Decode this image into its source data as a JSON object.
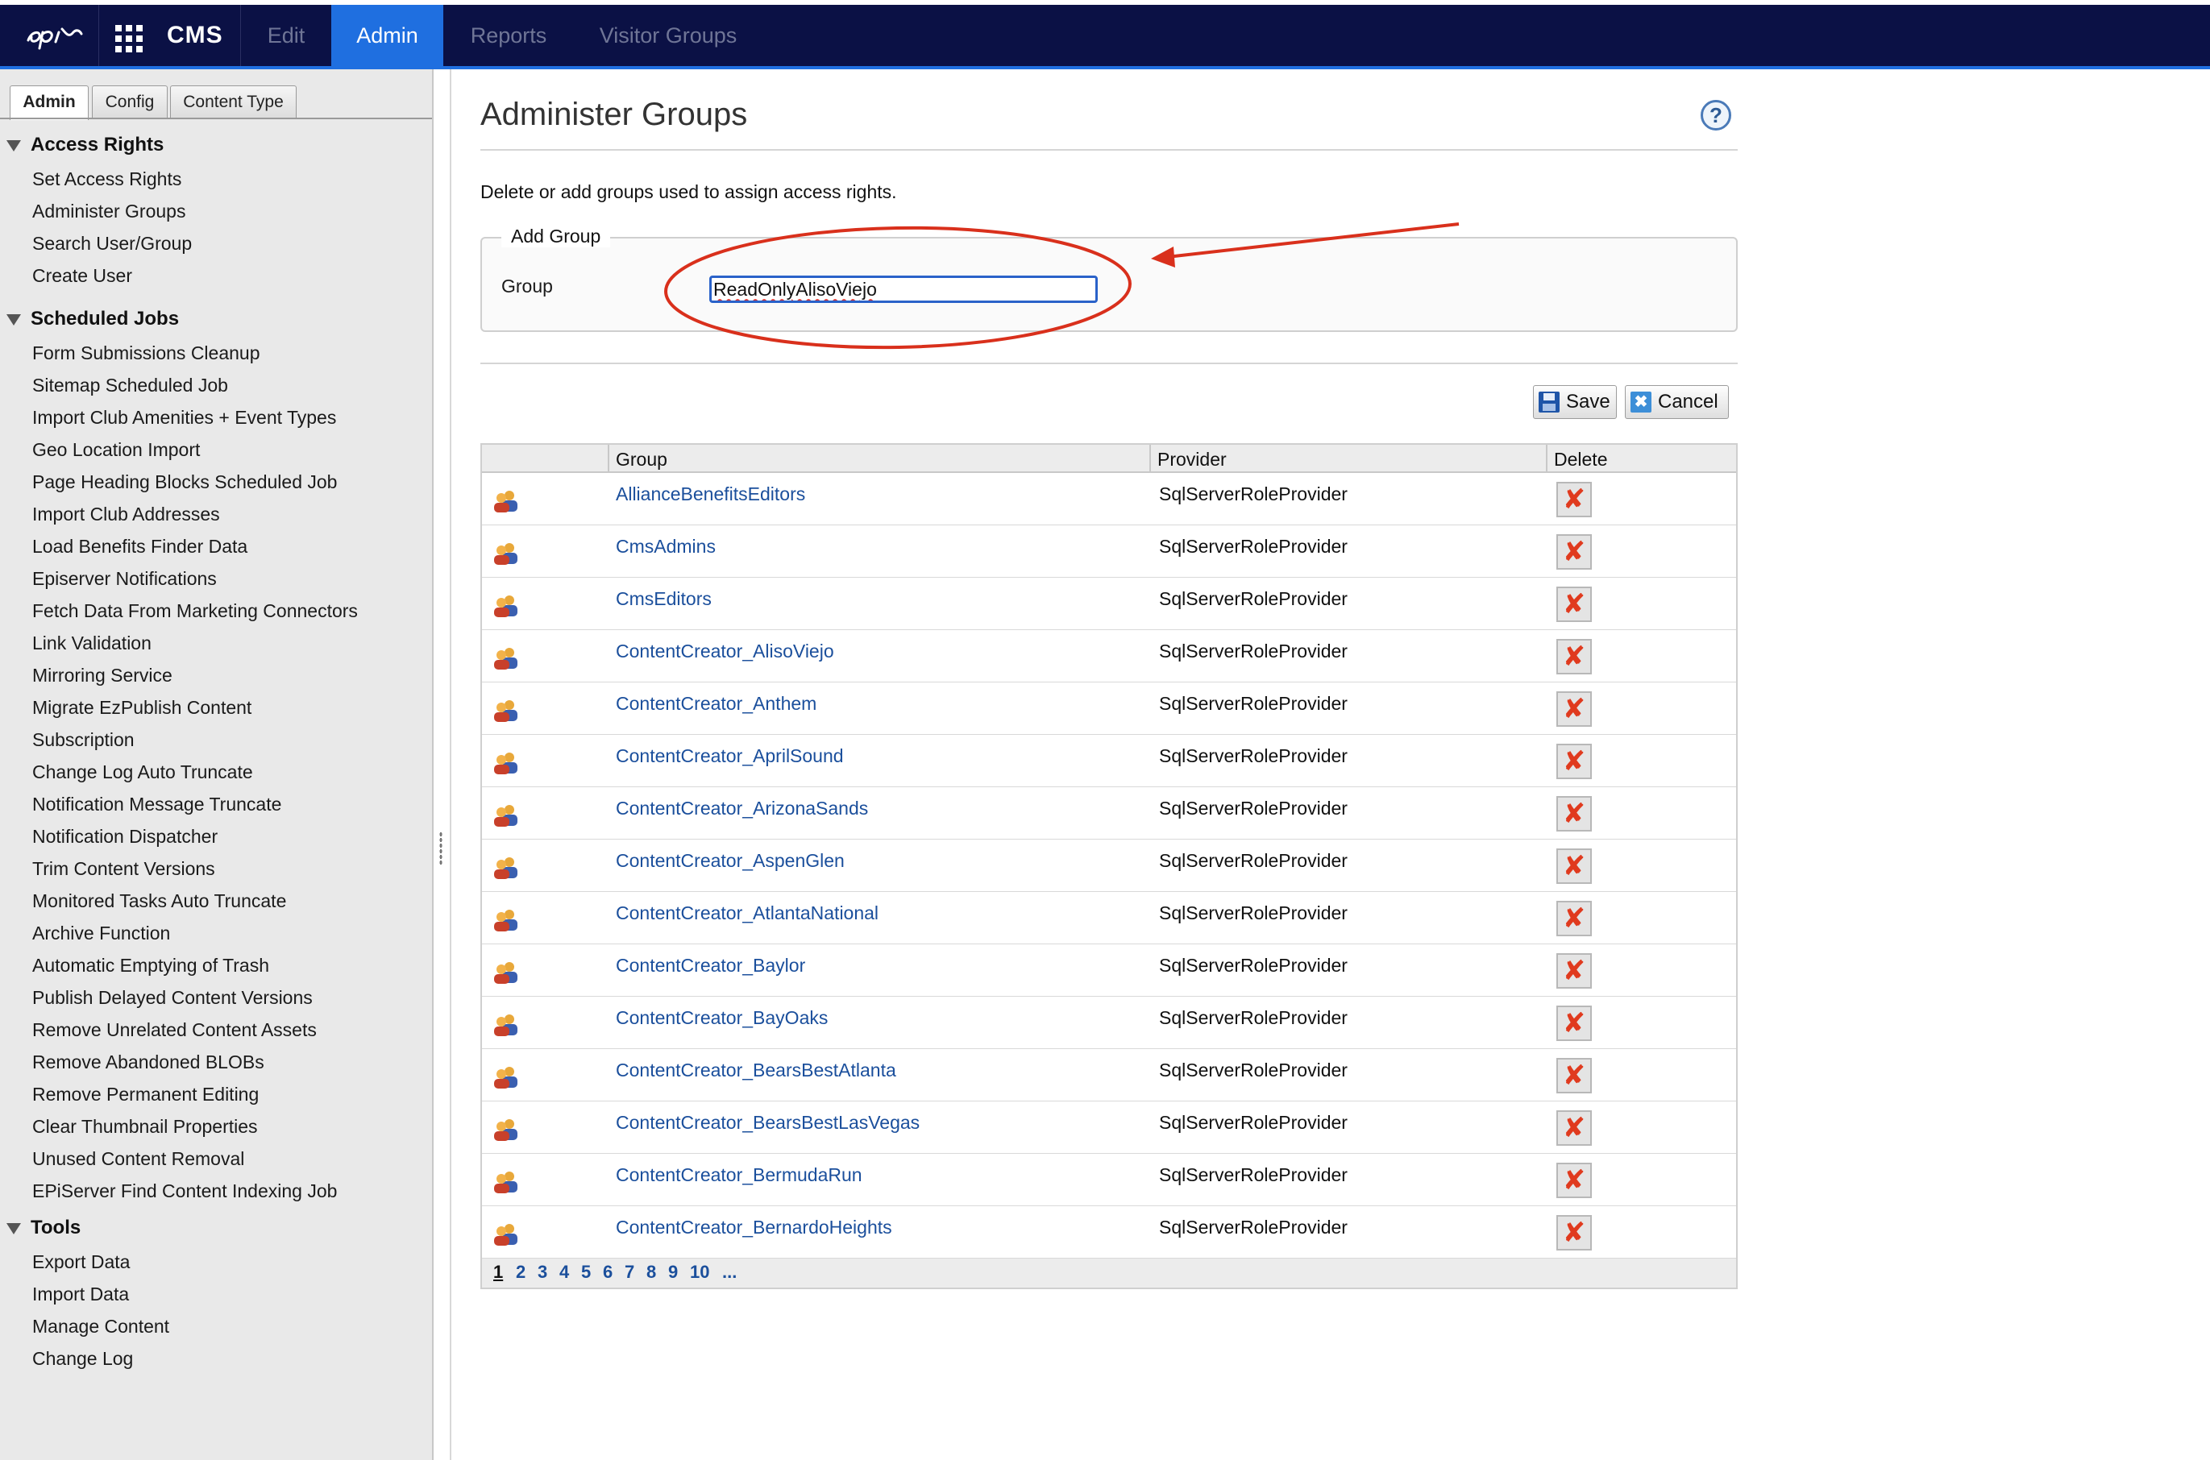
{
  "topbar": {
    "app_name": "CMS",
    "tabs": [
      {
        "label": "Edit",
        "active": false
      },
      {
        "label": "Admin",
        "active": true
      },
      {
        "label": "Reports",
        "active": false
      },
      {
        "label": "Visitor Groups",
        "active": false
      }
    ],
    "colors": {
      "bar": "#0b1145",
      "accent": "#1f6fe0"
    }
  },
  "sidebar": {
    "tabs": [
      {
        "label": "Admin",
        "active": true
      },
      {
        "label": "Config",
        "active": false
      },
      {
        "label": "Content Type",
        "active": false
      }
    ],
    "sections": [
      {
        "title": "Access Rights",
        "items": [
          "Set Access Rights",
          "Administer Groups",
          "Search User/Group",
          "Create User"
        ]
      },
      {
        "title": "Scheduled Jobs",
        "items": [
          "Form Submissions Cleanup",
          "Sitemap Scheduled Job",
          "Import Club Amenities + Event Types",
          "Geo Location Import",
          "Page Heading Blocks Scheduled Job",
          "Import Club Addresses",
          "Load Benefits Finder Data",
          "Episerver Notifications",
          "Fetch Data From Marketing Connectors",
          "Link Validation",
          "Mirroring Service",
          "Migrate EzPublish Content",
          "Subscription",
          "Change Log Auto Truncate",
          "Notification Message Truncate",
          "Notification Dispatcher",
          "Trim Content Versions",
          "Monitored Tasks Auto Truncate",
          "Archive Function",
          "Automatic Emptying of Trash",
          "Publish Delayed Content Versions",
          "Remove Unrelated Content Assets",
          "Remove Abandoned BLOBs",
          "Remove Permanent Editing",
          "Clear Thumbnail Properties",
          "Unused Content Removal",
          "EPiServer Find Content Indexing Job"
        ]
      },
      {
        "title": "Tools",
        "items": [
          "Export Data",
          "Import Data",
          "Manage Content",
          "Change Log"
        ]
      }
    ]
  },
  "main": {
    "title": "Administer Groups",
    "help_symbol": "?",
    "description": "Delete or add groups used to assign access rights.",
    "add_group": {
      "legend": "Add Group",
      "field_label": "Group",
      "field_value": "ReadOnlyAlisoViejo"
    },
    "buttons": {
      "save": "Save",
      "cancel": "Cancel",
      "cancel_symbol": "✖"
    },
    "table": {
      "headers": {
        "group": "Group",
        "provider": "Provider",
        "delete": "Delete"
      },
      "delete_symbol": "✘",
      "rows": [
        {
          "group": "AllianceBenefitsEditors",
          "provider": "SqlServerRoleProvider"
        },
        {
          "group": "CmsAdmins",
          "provider": "SqlServerRoleProvider"
        },
        {
          "group": "CmsEditors",
          "provider": "SqlServerRoleProvider"
        },
        {
          "group": "ContentCreator_AlisoViejo",
          "provider": "SqlServerRoleProvider"
        },
        {
          "group": "ContentCreator_Anthem",
          "provider": "SqlServerRoleProvider"
        },
        {
          "group": "ContentCreator_AprilSound",
          "provider": "SqlServerRoleProvider"
        },
        {
          "group": "ContentCreator_ArizonaSands",
          "provider": "SqlServerRoleProvider"
        },
        {
          "group": "ContentCreator_AspenGlen",
          "provider": "SqlServerRoleProvider"
        },
        {
          "group": "ContentCreator_AtlantaNational",
          "provider": "SqlServerRoleProvider"
        },
        {
          "group": "ContentCreator_Baylor",
          "provider": "SqlServerRoleProvider"
        },
        {
          "group": "ContentCreator_BayOaks",
          "provider": "SqlServerRoleProvider"
        },
        {
          "group": "ContentCreator_BearsBestAtlanta",
          "provider": "SqlServerRoleProvider"
        },
        {
          "group": "ContentCreator_BearsBestLasVegas",
          "provider": "SqlServerRoleProvider"
        },
        {
          "group": "ContentCreator_BermudaRun",
          "provider": "SqlServerRoleProvider"
        },
        {
          "group": "ContentCreator_BernardoHeights",
          "provider": "SqlServerRoleProvider"
        }
      ]
    },
    "pager": {
      "pages": [
        "1",
        "2",
        "3",
        "4",
        "5",
        "6",
        "7",
        "8",
        "9",
        "10",
        "..."
      ],
      "current": "1"
    },
    "annotation_color": "#d9301c"
  }
}
